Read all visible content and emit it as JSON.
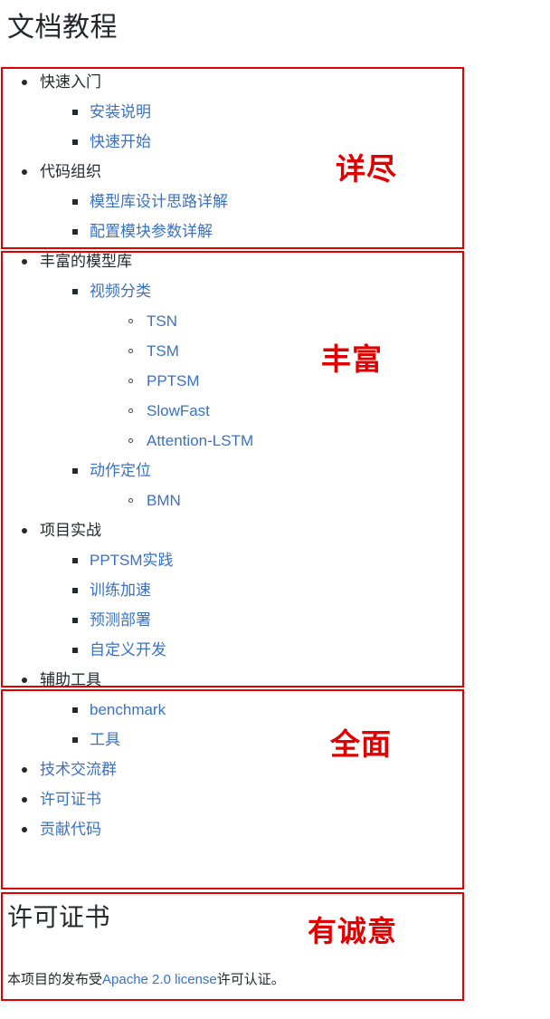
{
  "page": {
    "title": "文档教程"
  },
  "annotations": [
    {
      "label": "详尽"
    },
    {
      "label": "丰富"
    },
    {
      "label": "全面"
    },
    {
      "label": "有诚意"
    }
  ],
  "outline": {
    "items": [
      {
        "label": "快速入门",
        "type": "plain",
        "children": [
          {
            "label": "安装说明",
            "type": "link"
          },
          {
            "label": "快速开始",
            "type": "link"
          }
        ]
      },
      {
        "label": "代码组织",
        "type": "plain",
        "children": [
          {
            "label": "模型库设计思路详解",
            "type": "link"
          },
          {
            "label": "配置模块参数详解",
            "type": "link"
          }
        ]
      },
      {
        "label": "丰富的模型库",
        "type": "plain",
        "children": [
          {
            "label": "视频分类",
            "type": "link",
            "children": [
              {
                "label": "TSN",
                "type": "link"
              },
              {
                "label": "TSM",
                "type": "link"
              },
              {
                "label": "PPTSM",
                "type": "link"
              },
              {
                "label": "SlowFast",
                "type": "link"
              },
              {
                "label": "Attention-LSTM",
                "type": "link"
              }
            ]
          },
          {
            "label": "动作定位",
            "type": "link",
            "children": [
              {
                "label": "BMN",
                "type": "link"
              }
            ]
          }
        ]
      },
      {
        "label": "项目实战",
        "type": "plain",
        "children": [
          {
            "label": "PPTSM实践",
            "type": "link"
          },
          {
            "label": "训练加速",
            "type": "link"
          },
          {
            "label": "预测部署",
            "type": "link"
          },
          {
            "label": "自定义开发",
            "type": "link"
          }
        ]
      },
      {
        "label": "辅助工具",
        "type": "plain",
        "children": [
          {
            "label": "benchmark",
            "type": "link"
          },
          {
            "label": "工具",
            "type": "link"
          }
        ]
      },
      {
        "label": "技术交流群",
        "type": "link"
      },
      {
        "label": "许可证书",
        "type": "link"
      },
      {
        "label": "贡献代码",
        "type": "link"
      }
    ]
  },
  "license": {
    "heading": "许可证书",
    "text_before": "本项目的发布受",
    "link_text": "Apache 2.0 license",
    "text_after": "许可认证。"
  },
  "colors": {
    "link": "#3a72c0",
    "text": "#24292e",
    "annotation": "#e00000"
  }
}
